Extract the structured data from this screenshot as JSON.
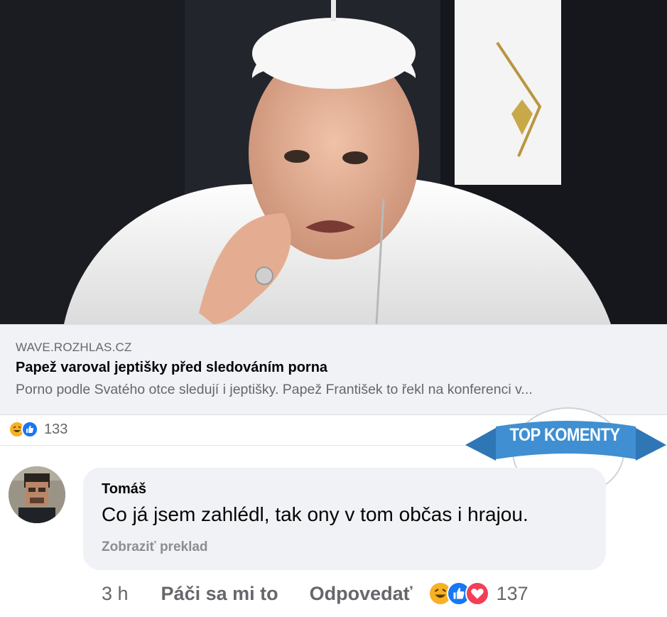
{
  "post": {
    "link_domain": "WAVE.ROZHLAS.CZ",
    "link_title": "Papež varoval jeptišky před sledováním porna",
    "link_description": "Porno podle Svatého otce sledují i jeptišky. Papež František to řekl na konferenci v...",
    "reactions": [
      "haha-icon",
      "like-icon"
    ],
    "reaction_count": "133"
  },
  "badge": {
    "label": "TOP KOMENTY",
    "color": "#3f8fd2"
  },
  "comment": {
    "author": "Tomáš",
    "text": "Co já jsem zahlédl, tak ony v tom občas i hrajou.",
    "translate_label": "Zobraziť preklad",
    "time": "3 h",
    "like_label": "Páči sa mi to",
    "reply_label": "Odpovedať",
    "reactions": [
      "haha-icon",
      "like-icon",
      "love-icon"
    ],
    "reaction_count": "137"
  },
  "colors": {
    "like": "#1877f2",
    "love": "#f33e58",
    "haha": "#f7b125",
    "secondary_text": "#65676b"
  }
}
